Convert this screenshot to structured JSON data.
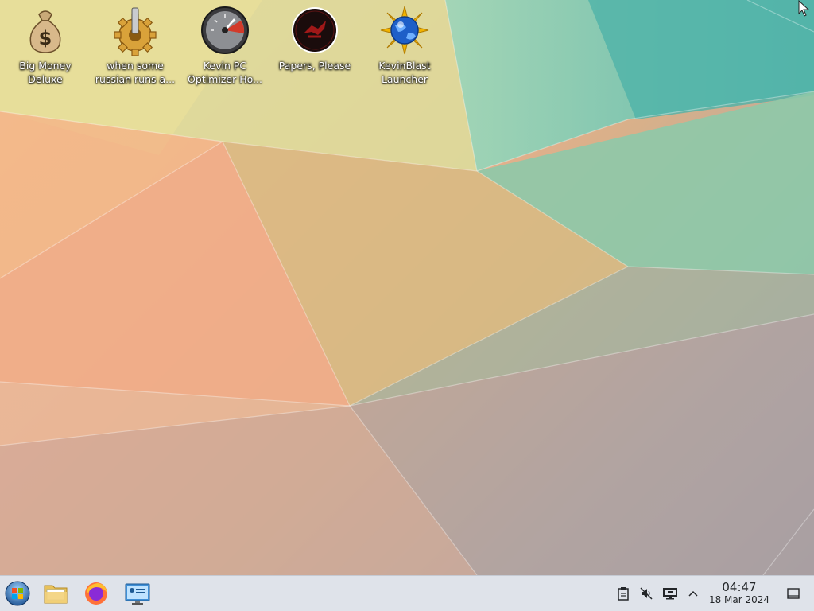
{
  "desktop": {
    "icons": [
      {
        "label": "Big Money\nDeluxe",
        "icon": "money-bag-icon"
      },
      {
        "label": "when some\nrussian runs a...",
        "icon": "gear-icon"
      },
      {
        "label": "Kevin PC\nOptimizer Ho...",
        "icon": "speedometer-icon"
      },
      {
        "label": "Papers, Please",
        "icon": "papers-please-icon"
      },
      {
        "label": "KevinBlast\nLauncher",
        "icon": "kevinblast-globe-icon"
      }
    ]
  },
  "taskbar": {
    "launchers": [
      {
        "name": "start-menu",
        "icon": "start-orb-icon"
      },
      {
        "name": "file-manager",
        "icon": "folder-icon"
      },
      {
        "name": "firefox",
        "icon": "firefox-icon"
      },
      {
        "name": "system-settings",
        "icon": "control-panel-icon"
      }
    ],
    "tray": [
      {
        "name": "clipboard",
        "icon": "clipboard-icon"
      },
      {
        "name": "volume-muted",
        "icon": "speaker-muted-icon"
      },
      {
        "name": "display",
        "icon": "monitor-icon"
      },
      {
        "name": "show-hidden",
        "icon": "chevron-up-icon"
      }
    ],
    "clock": {
      "time": "04:47",
      "date": "18 Mar 2024"
    }
  },
  "colors": {
    "taskbar_bg": "#dfe3ea",
    "label_text": "#ffffff",
    "clock_text": "#232629"
  }
}
